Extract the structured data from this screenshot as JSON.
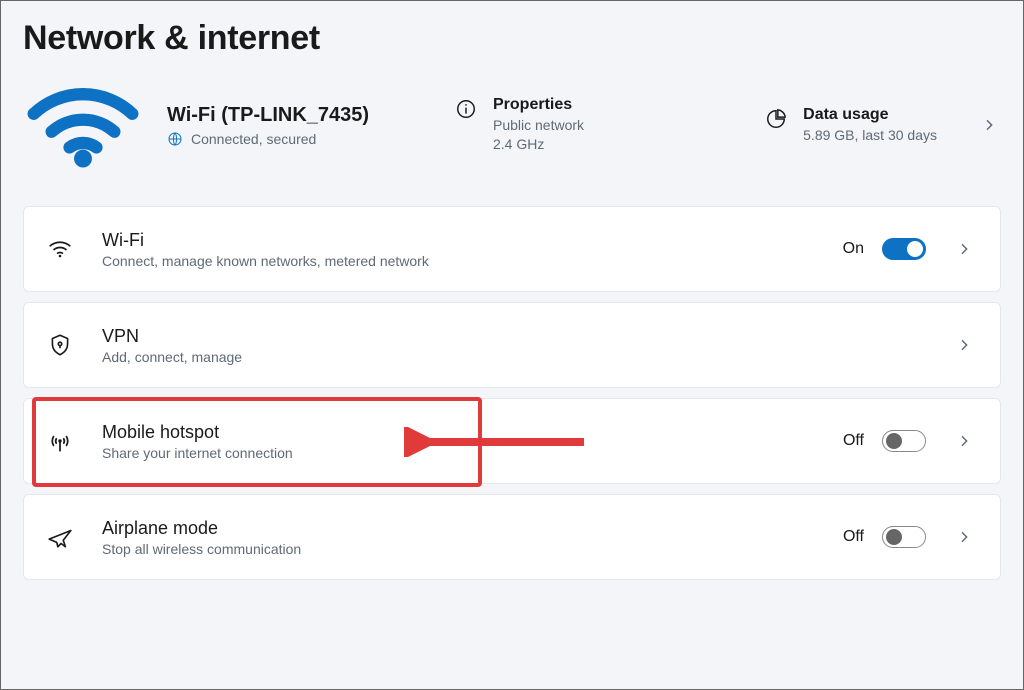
{
  "header": {
    "title": "Network & internet"
  },
  "status": {
    "network_name": "Wi-Fi (TP-LINK_7435)",
    "connection_status": "Connected, secured",
    "properties": {
      "label": "Properties",
      "line1": "Public network",
      "line2": "2.4 GHz"
    },
    "data_usage": {
      "label": "Data usage",
      "line1": "5.89 GB, last 30 days"
    }
  },
  "items": {
    "wifi": {
      "title": "Wi-Fi",
      "sub": "Connect, manage known networks, metered network",
      "state_label": "On",
      "state_on": true
    },
    "vpn": {
      "title": "VPN",
      "sub": "Add, connect, manage"
    },
    "hotspot": {
      "title": "Mobile hotspot",
      "sub": "Share your internet connection",
      "state_label": "Off",
      "state_on": false
    },
    "airplane": {
      "title": "Airplane mode",
      "sub": "Stop all wireless communication",
      "state_label": "Off",
      "state_on": false
    }
  },
  "annotation": {
    "highlight_target": "hotspot"
  }
}
